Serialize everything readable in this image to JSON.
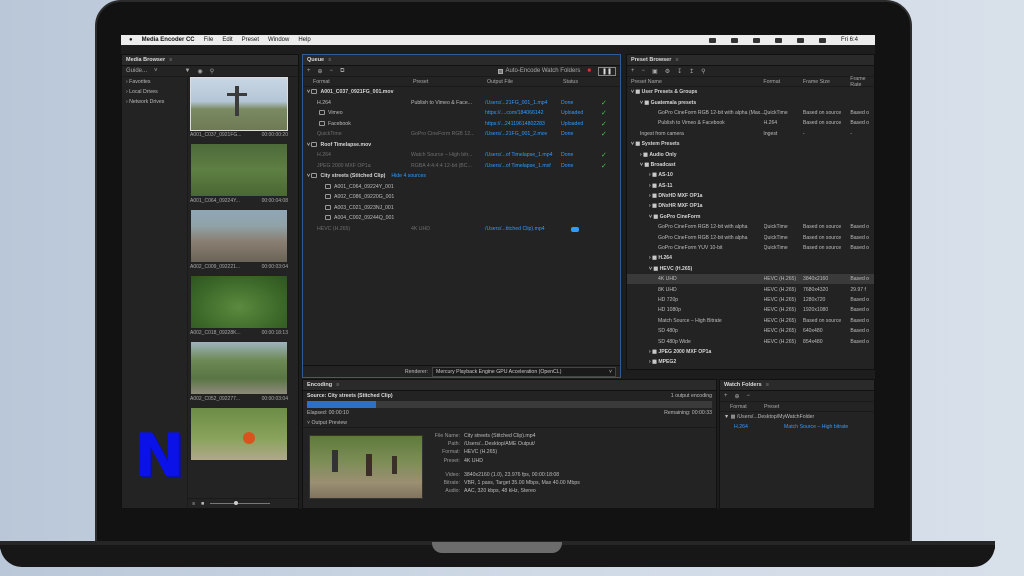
{
  "menubar": {
    "apple": "",
    "app": "Media Encoder CC",
    "items": [
      "File",
      "Edit",
      "Preset",
      "Window",
      "Help"
    ],
    "clock": "Fri 6:4"
  },
  "media_browser": {
    "title": "Media Browser",
    "location": "Guide...",
    "tree": [
      "Favorites",
      "Local Drives",
      "Network Drives"
    ],
    "thumbs": [
      {
        "name": "A001_C037_0921FG...",
        "duration": "00:00:00:20"
      },
      {
        "name": "A001_C064_09224Y...",
        "duration": "00:00:04:08"
      },
      {
        "name": "A002_C009_092221...",
        "duration": "00:00:03:04"
      },
      {
        "name": "A002_C018_09228K...",
        "duration": "00:00:18:13"
      },
      {
        "name": "A002_C052_092277...",
        "duration": "00:00:03:04"
      },
      {
        "name": "",
        "duration": ""
      }
    ]
  },
  "queue": {
    "title": "Queue",
    "auto_encode": "Auto-Encode Watch Folders",
    "columns": [
      "Format",
      "Preset",
      "Output File",
      "Status"
    ],
    "rows": [
      {
        "kind": "group",
        "name": "A001_C037_0921FG_001.mov"
      },
      {
        "kind": "item",
        "format": "H.264",
        "preset": "Publish to Vimeo & Face...",
        "output": "/Users/...21FG_001_1.mp4",
        "status": "Done",
        "check": true
      },
      {
        "kind": "sub",
        "format": "Vimeo",
        "preset": "",
        "output": "https://....com/184066142",
        "status": "Uploaded",
        "check": true
      },
      {
        "kind": "sub",
        "format": "Facebook",
        "preset": "",
        "output": "https://...24119614802283",
        "status": "Uploaded",
        "check": true
      },
      {
        "kind": "item-dim",
        "format": "QuickTime",
        "preset": "GoPro CineForm RGB 12...",
        "output": "/Users/...21FG_001_2.mov",
        "status": "Done",
        "check": true
      },
      {
        "kind": "group",
        "name": "Roof Timelapse.mov"
      },
      {
        "kind": "item-dim",
        "format": "H.264",
        "preset": "Watch Source – High bitr...",
        "output": "/Users/...of Timelapse_1.mp4",
        "status": "Done",
        "check": true
      },
      {
        "kind": "item-dim",
        "format": "JPEG 2000 MXF OP1a",
        "preset": "RGBA 4:4:4:4 12-bit (BC...",
        "output": "/Users/...of Timelapse_1.mxf",
        "status": "Done",
        "check": true
      },
      {
        "kind": "group",
        "name": "City streets (Stitched Clip)",
        "extra": "Hide 4 sources"
      },
      {
        "kind": "src",
        "format": "A001_C064_09224Y_001"
      },
      {
        "kind": "src",
        "format": "A002_C086_09220G_001"
      },
      {
        "kind": "src",
        "format": "A003_C021_0923NJ_001"
      },
      {
        "kind": "src",
        "format": "A004_C002_09244Q_001"
      },
      {
        "kind": "item-dim",
        "format": "HEVC (H.265)",
        "preset": "4K UHD",
        "output": "/Users/...titched Clip).mp4",
        "status": "",
        "check": false,
        "progress": true
      }
    ],
    "renderer_label": "Renderer:",
    "renderer_value": "Mercury Playback Engine GPU Acceleration (OpenCL)"
  },
  "encoding": {
    "title": "Encoding",
    "source": "Source: City streets (Stitched Clip)",
    "outputs": "1 output encoding",
    "elapsed": "Elapsed: 00:00:10",
    "remaining": "Remaining: 00:00:33",
    "progress": 0.17,
    "preview_label": "Output Preview",
    "info": [
      {
        "k": "File Name:",
        "v": "City streets (Stitched Clip).mp4"
      },
      {
        "k": "Path:",
        "v": "/Users/...Desktop/AME Output/"
      },
      {
        "k": "Format:",
        "v": "HEVC (H.265)"
      },
      {
        "k": "Preset:",
        "v": "4K UHD"
      },
      {
        "k": "",
        "v": ""
      },
      {
        "k": "Video:",
        "v": "3840x2160 (1.0), 23.976 fps, 00:00:18:08"
      },
      {
        "k": "Bitrate:",
        "v": "VBR, 1 pass, Target 35.00 Mbps, Max 40.00 Mbps"
      },
      {
        "k": "Audio:",
        "v": "AAC, 320 kbps, 48 kHz, Stereo"
      }
    ]
  },
  "presets": {
    "title": "Preset Browser",
    "columns": [
      "Preset Name",
      "Format",
      "Frame Size",
      "Frame Rate"
    ],
    "rows": [
      {
        "indent": 0,
        "bold": true,
        "n": "User Presets & Groups",
        "f": "",
        "s": "",
        "r": ""
      },
      {
        "indent": 1,
        "bold": true,
        "n": "Guatemala presets",
        "f": "",
        "s": "",
        "r": ""
      },
      {
        "indent": 3,
        "n": "GoPro CineForm RGB 12-bit with alpha (Max...",
        "f": "QuickTime",
        "s": "Based on source",
        "r": "Based o"
      },
      {
        "indent": 3,
        "n": "Publish to Vimeo & Facebook",
        "f": "H.264",
        "s": "Based on source",
        "r": "Based o"
      },
      {
        "indent": 1,
        "n": "Ingest from camera",
        "f": "Ingest",
        "s": "-",
        "r": "-"
      },
      {
        "indent": 0,
        "bold": true,
        "n": "System Presets",
        "f": "",
        "s": "",
        "r": ""
      },
      {
        "indent": 1,
        "bold": true,
        "n": "Audio Only",
        "f": "",
        "s": "",
        "r": ""
      },
      {
        "indent": 1,
        "bold": true,
        "n": "Broadcast",
        "f": "",
        "s": "",
        "r": ""
      },
      {
        "indent": 2,
        "bold": true,
        "n": "AS-10",
        "f": "",
        "s": "",
        "r": ""
      },
      {
        "indent": 2,
        "bold": true,
        "n": "AS-11",
        "f": "",
        "s": "",
        "r": ""
      },
      {
        "indent": 2,
        "bold": true,
        "n": "DNxHD MXF OP1a",
        "f": "",
        "s": "",
        "r": ""
      },
      {
        "indent": 2,
        "bold": true,
        "n": "DNxHR MXF OP1a",
        "f": "",
        "s": "",
        "r": ""
      },
      {
        "indent": 2,
        "bold": true,
        "n": "GoPro CineForm",
        "f": "",
        "s": "",
        "r": ""
      },
      {
        "indent": 3,
        "n": "GoPro CineForm RGB 12-bit with alpha",
        "f": "QuickTime",
        "s": "Based on source",
        "r": "Based o"
      },
      {
        "indent": 3,
        "n": "GoPro CineForm RGB 12-bit with alpha",
        "f": "QuickTime",
        "s": "Based on source",
        "r": "Based o"
      },
      {
        "indent": 3,
        "n": "GoPro CineForm YUV 10-bit",
        "f": "QuickTime",
        "s": "Based on source",
        "r": "Based o"
      },
      {
        "indent": 2,
        "bold": true,
        "n": "H.264",
        "f": "",
        "s": "",
        "r": ""
      },
      {
        "indent": 2,
        "bold": true,
        "n": "HEVC (H.265)",
        "f": "",
        "s": "",
        "r": ""
      },
      {
        "indent": 3,
        "n": "4K UHD",
        "f": "HEVC (H.265)",
        "s": "3840x2160",
        "r": "Based o",
        "hl": true
      },
      {
        "indent": 3,
        "n": "8K UHD",
        "f": "HEVC (H.265)",
        "s": "7680x4320",
        "r": "29.97 f"
      },
      {
        "indent": 3,
        "n": "HD 720p",
        "f": "HEVC (H.265)",
        "s": "1280x720",
        "r": "Based o"
      },
      {
        "indent": 3,
        "n": "HD 1080p",
        "f": "HEVC (H.265)",
        "s": "1920x1080",
        "r": "Based o"
      },
      {
        "indent": 3,
        "n": "Match Source – High Bitrate",
        "f": "HEVC (H.265)",
        "s": "Based on source",
        "r": "Based o"
      },
      {
        "indent": 3,
        "n": "SD 480p",
        "f": "HEVC (H.265)",
        "s": "640x480",
        "r": "Based o"
      },
      {
        "indent": 3,
        "n": "SD 480p Wide",
        "f": "HEVC (H.265)",
        "s": "854x480",
        "r": "Based o"
      },
      {
        "indent": 2,
        "bold": true,
        "n": "JPEG 2000 MXF OP1a",
        "f": "",
        "s": "",
        "r": ""
      },
      {
        "indent": 2,
        "bold": true,
        "n": "MPEG2",
        "f": "",
        "s": "",
        "r": ""
      }
    ]
  },
  "watch": {
    "title": "Watch Folders",
    "columns": [
      "Format",
      "Preset"
    ],
    "folder": "/Users/...Desktop/MyWatchFolder",
    "format": "H.264",
    "preset": "Match Source – High bitrate"
  }
}
